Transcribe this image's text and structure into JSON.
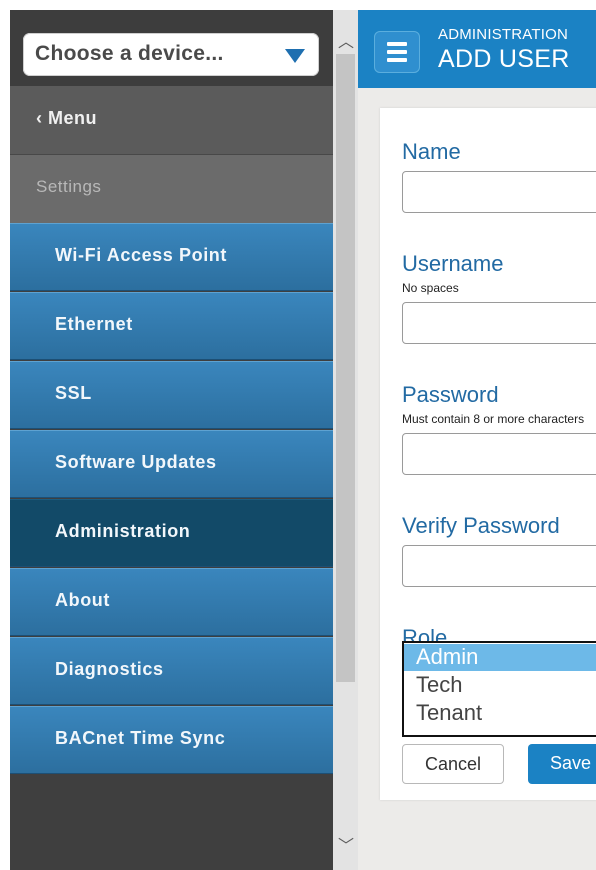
{
  "device_selector": {
    "label": "Choose a device..."
  },
  "sidebar": {
    "back_label": "Menu",
    "section_header": "Settings",
    "items": [
      {
        "label": "Wi-Fi Access Point",
        "active": false
      },
      {
        "label": "Ethernet",
        "active": false
      },
      {
        "label": "SSL",
        "active": false
      },
      {
        "label": "Software Updates",
        "active": false
      },
      {
        "label": "Administration",
        "active": true
      },
      {
        "label": "About",
        "active": false
      },
      {
        "label": "Diagnostics",
        "active": false
      },
      {
        "label": "BACnet Time Sync",
        "active": false
      }
    ]
  },
  "header": {
    "breadcrumb": "ADMINISTRATION",
    "title": "ADD USER"
  },
  "form": {
    "name_label": "Name",
    "username_label": "Username",
    "username_hint": "No spaces",
    "password_label": "Password",
    "password_hint": "Must contain 8 or more characters",
    "verify_label": "Verify Password",
    "role_label": "Role",
    "role_options": [
      "Admin",
      "Tech",
      "Tenant"
    ],
    "role_selected": "Admin",
    "cancel_label": "Cancel",
    "save_label": "Save"
  },
  "colors": {
    "accent": "#1b82c4",
    "nav_blue": "#3180b5",
    "nav_active": "#124a68",
    "label_blue": "#226aa3"
  }
}
